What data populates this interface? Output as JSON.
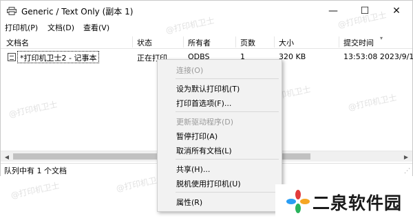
{
  "window": {
    "title": "Generic / Text Only (副本 1)",
    "controls": {
      "minimize": "—",
      "maximize": "☐",
      "close": "✕"
    }
  },
  "menubar": [
    "打印机(P)",
    "文档(D)",
    "查看(V)"
  ],
  "columns": [
    "文档名",
    "状态",
    "所有者",
    "页数",
    "大小",
    "提交时间"
  ],
  "jobs": [
    {
      "name": "*打印机卫士2 - 记事本",
      "status": "正在打印",
      "owner": "ODBS",
      "pages": "1",
      "size": "320 KB",
      "submitted": "13:53:08   2023/9/1"
    }
  ],
  "status_bar": {
    "text": "队列中有 1 个文档"
  },
  "context_menu": [
    {
      "label": "连接(O)",
      "enabled": false
    },
    {
      "label": "设为默认打印机(T)",
      "enabled": true
    },
    {
      "label": "打印首选项(F)...",
      "enabled": true
    },
    {
      "label": "更新驱动程序(D)",
      "enabled": false
    },
    {
      "label": "暂停打印(A)",
      "enabled": true
    },
    {
      "label": "取消所有文档(L)",
      "enabled": true
    },
    {
      "label": "共享(H)...",
      "enabled": true
    },
    {
      "label": "脱机使用打印机(U)",
      "enabled": true
    },
    {
      "label": "属性(R)",
      "enabled": true
    }
  ],
  "watermark_text": "@打印机卫士",
  "brand": {
    "logo_text": "二泉软件园"
  },
  "colors": {
    "accent_logo": [
      "#e23b3b",
      "#f5a623",
      "#2a9df4",
      "#29b35c"
    ]
  }
}
